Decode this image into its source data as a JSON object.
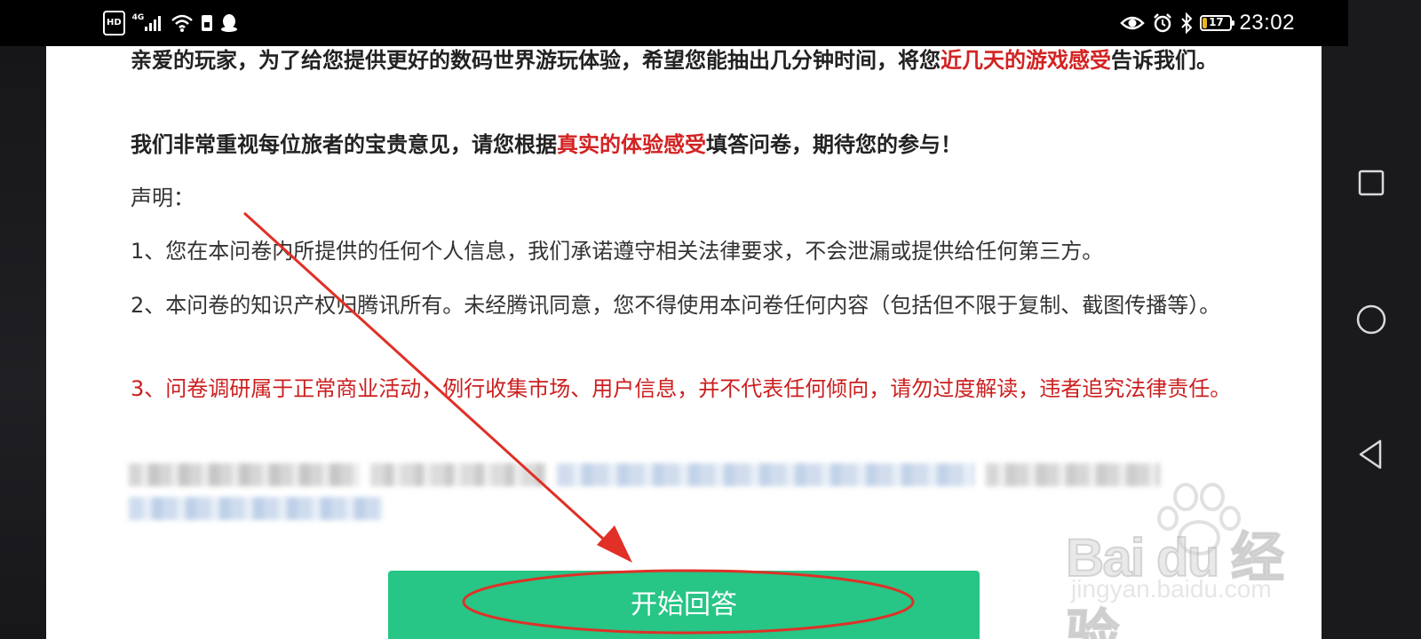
{
  "status_bar": {
    "hd": "HD",
    "network": "4G",
    "battery_level": 17,
    "battery_label": "17",
    "time": "23:02",
    "left_icons": [
      "hd-badge",
      "signal-icon",
      "wifi-icon",
      "sim-icon",
      "qq-icon"
    ],
    "right_icons": [
      "eye-icon",
      "alarm-icon",
      "bluetooth-icon",
      "battery-icon"
    ]
  },
  "content": {
    "p1": {
      "before": "亲爱的玩家，为了给您提供更好的数码世界游玩体验，希望您能抽出几分钟时间，将您",
      "highlight": "近几天的游戏感受",
      "after": "告诉我们。"
    },
    "p2": {
      "before": "我们非常重视每位旅者的宝贵意见，请您根据",
      "highlight": "真实的体验感受",
      "after": "填答问卷，期待您的参与！"
    },
    "p3": "声明：",
    "p4": "1、您在本问卷内所提供的任何个人信息，我们承诺遵守相关法律要求，不会泄漏或提供给任何第三方。",
    "p5": "2、本问卷的知识产权归腾讯所有。未经腾讯同意，您不得使用本问卷任何内容（包括但不限于复制、截图传播等）。",
    "p6": "3、问卷调研属于正常商业活动，例行收集市场、用户信息，并不代表任何倾向，请勿过度解读，违者追究法律责任。"
  },
  "start_button": {
    "label": "开始回答"
  },
  "nav_bar": {
    "recent": "square-icon",
    "home": "circle-icon",
    "back": "triangle-back-icon"
  },
  "colors": {
    "accent_green": "#27c586",
    "highlight_red": "#d32222",
    "annotation_red": "#e03027"
  }
}
